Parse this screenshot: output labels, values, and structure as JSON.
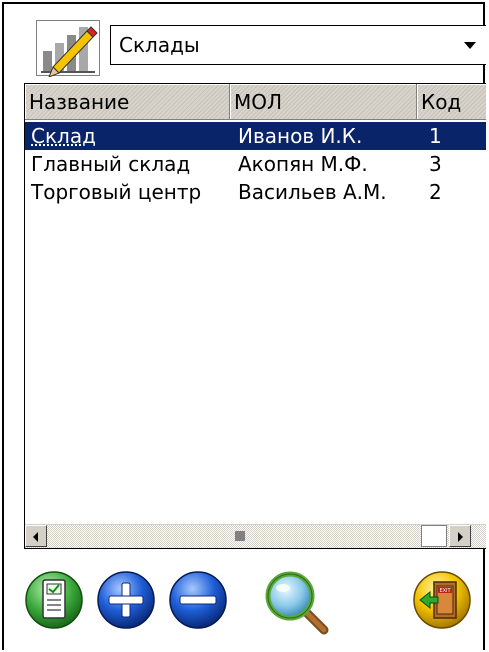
{
  "header": {
    "app_icon": "chart-pencil-icon",
    "dropdown": {
      "selected": "Склады",
      "arrow_icon": "chevron-down-icon"
    }
  },
  "table": {
    "columns": [
      "Название",
      "МОЛ",
      "Код"
    ],
    "rows": [
      {
        "name": "Склад",
        "mol": "Иванов И.К.",
        "code": "1",
        "selected": true
      },
      {
        "name": "Главный склад",
        "mol": "Акопян М.Ф.",
        "code": "3",
        "selected": false
      },
      {
        "name": "Торговый центр",
        "mol": "Васильев А.М.",
        "code": "2",
        "selected": false
      }
    ]
  },
  "toolbar": {
    "edit_icon": "edit-document-icon",
    "add_icon": "plus-icon",
    "remove_icon": "minus-icon",
    "search_icon": "magnifier-icon",
    "exit_icon": "exit-door-icon",
    "exit_sign": "EXIT"
  },
  "colors": {
    "selection": "#0a246a",
    "green": "#3aa83a",
    "blue": "#1f5fd8",
    "yellow": "#f2c200"
  }
}
